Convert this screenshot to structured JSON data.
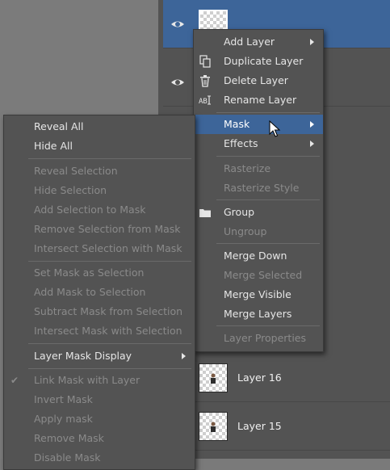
{
  "layers": [
    {
      "name": "",
      "selected": true,
      "visible": true
    },
    {
      "name": "",
      "selected": false,
      "visible": true
    },
    {
      "name": "Layer 16",
      "selected": false,
      "visible": false
    },
    {
      "name": "Layer 15",
      "selected": false,
      "visible": false
    }
  ],
  "main_menu": {
    "add_layer": "Add Layer",
    "duplicate_layer": "Duplicate Layer",
    "delete_layer": "Delete Layer",
    "rename_layer": "Rename Layer",
    "mask": "Mask",
    "effects": "Effects",
    "rasterize": "Rasterize",
    "rasterize_style": "Rasterize Style",
    "group": "Group",
    "ungroup": "Ungroup",
    "merge_down": "Merge Down",
    "merge_selected": "Merge Selected",
    "merge_visible": "Merge Visible",
    "merge_layers": "Merge Layers",
    "layer_properties": "Layer Properties"
  },
  "mask_menu": {
    "reveal_all": "Reveal All",
    "hide_all": "Hide All",
    "reveal_selection": "Reveal Selection",
    "hide_selection": "Hide Selection",
    "add_selection_to_mask": "Add Selection to Mask",
    "remove_selection_from_mask": "Remove Selection from Mask",
    "intersect_selection_with_mask": "Intersect Selection with Mask",
    "set_mask_as_selection": "Set Mask as Selection",
    "add_mask_to_selection": "Add Mask to Selection",
    "subtract_mask_from_selection": "Subtract Mask from Selection",
    "intersect_mask_with_selection": "Intersect Mask with Selection",
    "layer_mask_display": "Layer Mask Display",
    "link_mask_with_layer": "Link Mask with Layer",
    "invert_mask": "Invert Mask",
    "apply_mask": "Apply mask",
    "remove_mask": "Remove Mask",
    "disable_mask": "Disable Mask"
  },
  "colors": {
    "panel_bg": "#535353",
    "highlight": "#3d6599",
    "text": "#e6e6e6",
    "disabled_text": "#8a8a8a"
  }
}
